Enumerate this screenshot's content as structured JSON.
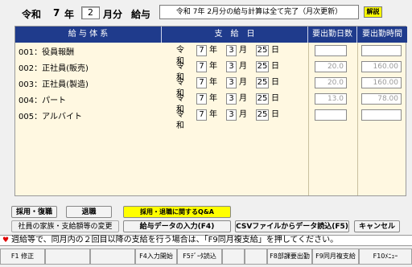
{
  "header": {
    "era": "令和",
    "year": "7",
    "year_unit": "年",
    "month": "2",
    "month_unit": "月分",
    "title": "給与",
    "status": "令和 7年 2月分の給与計算は全て完了（月次更新）",
    "help_label": "解説"
  },
  "grid": {
    "col_employee": "給 与 体 系",
    "col_payday": "支　給　日",
    "col_days": "要出勤日数",
    "col_hours": "要出勤時間",
    "rows": [
      {
        "label": "001：役員報酬",
        "era": "令和",
        "y": "7",
        "y_unit": "年",
        "m": "3",
        "m_unit": "月",
        "d": "25",
        "d_unit": "日",
        "days": "",
        "hours": ""
      },
      {
        "label": "002：正社員(販売)",
        "era": "令和",
        "y": "7",
        "y_unit": "年",
        "m": "3",
        "m_unit": "月",
        "d": "25",
        "d_unit": "日",
        "days": "20.0",
        "hours": "160.00"
      },
      {
        "label": "003：正社員(製造)",
        "era": "令和",
        "y": "7",
        "y_unit": "年",
        "m": "3",
        "m_unit": "月",
        "d": "25",
        "d_unit": "日",
        "days": "20.0",
        "hours": "160.00"
      },
      {
        "label": "004：パート",
        "era": "令和",
        "y": "7",
        "y_unit": "年",
        "m": "3",
        "m_unit": "月",
        "d": "25",
        "d_unit": "日",
        "days": "13.0",
        "hours": "78.00"
      },
      {
        "label": "005：アルバイト",
        "era": "令和",
        "y": "7",
        "y_unit": "年",
        "m": "3",
        "m_unit": "月",
        "d": "25",
        "d_unit": "日",
        "days": "",
        "hours": ""
      }
    ]
  },
  "buttons": {
    "saiyo": "採用・復職",
    "taishoku": "退職",
    "qa": "採用・退職に関するQ&A",
    "kazoku": "社員の家族・支給額等の変更",
    "input": "給与データの入力(F4)",
    "csv": "CSVファイルからデータ読込(F5)",
    "cancel": "キャンセル"
  },
  "message": "週給等で、同月内の２回目以降の支給を行う場合は、「F9同月複支給」を押してください。",
  "fkeys": [
    "F1 修正",
    "",
    "",
    "F4入力開始",
    "F5ﾃﾞｰﾀ読込",
    "",
    "",
    "F8部課要出勤",
    "F9同月複支給",
    "F10ﾒﾆｭｰ"
  ]
}
